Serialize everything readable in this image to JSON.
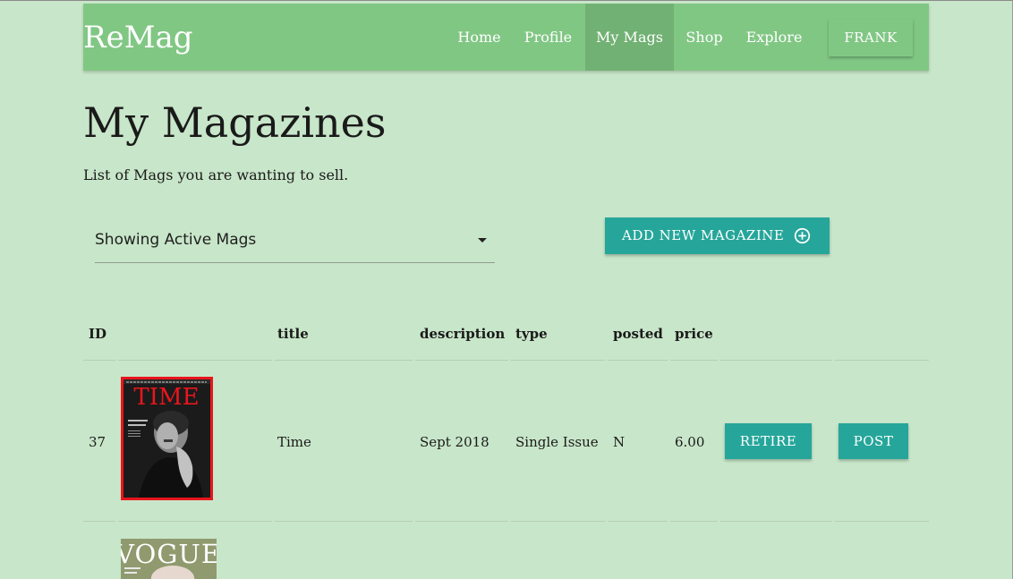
{
  "navbar": {
    "brand": "ReMag",
    "items": [
      {
        "label": "Home",
        "active": false
      },
      {
        "label": "Profile",
        "active": false
      },
      {
        "label": "My Mags",
        "active": true
      },
      {
        "label": "Shop",
        "active": false
      },
      {
        "label": "Explore",
        "active": false
      }
    ],
    "user_button": "FRANK"
  },
  "header": {
    "title": "My Magazines",
    "subtitle": "List of Mags you are wanting to sell."
  },
  "filter": {
    "selected": "Showing Active Mags"
  },
  "add_button": {
    "label": "ADD NEW MAGAZINE",
    "icon": "plus-circle-icon"
  },
  "table": {
    "columns": [
      "ID",
      "title",
      "description",
      "type",
      "posted",
      "price"
    ],
    "rows": [
      {
        "id": "37",
        "cover": {
          "masthead": "TIME",
          "border_color": "#e8161c"
        },
        "title": "Time",
        "description": "Sept 2018",
        "type": "Single Issue",
        "posted": "N",
        "price": "6.00",
        "actions": [
          "RETIRE",
          "POST"
        ]
      },
      {
        "cover": {
          "masthead": "VOGUE"
        }
      }
    ]
  },
  "colors": {
    "page_bg": "#c8e6c9",
    "navbar_bg": "#81c784",
    "navbar_active": "#71b173",
    "accent": "#26a69a"
  }
}
